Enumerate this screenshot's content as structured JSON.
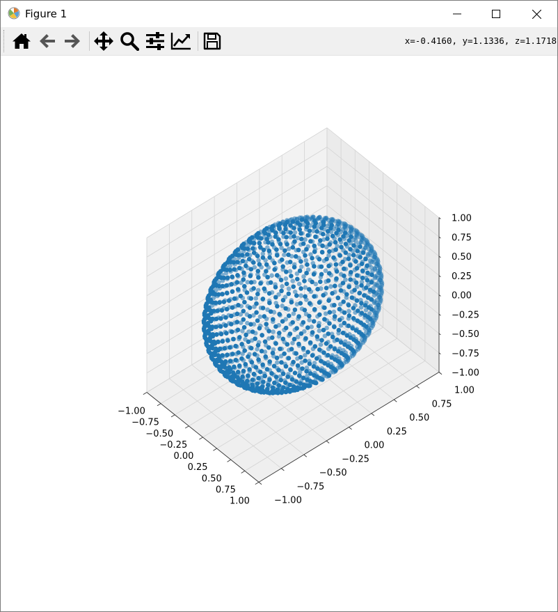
{
  "window": {
    "title": "Figure 1"
  },
  "toolbar": {
    "coords_text": "x=-0.4160, y=1.1336, z=1.1718",
    "buttons": [
      "home-icon",
      "back-arrow-icon",
      "forward-arrow-icon",
      "pan-move-icon",
      "zoom-magnifier-icon",
      "subplots-adjust-icon",
      "edit-axis-curve-icon",
      "save-floppy-icon"
    ]
  },
  "colors": {
    "marker": "#1f77b4",
    "pane": "#f2f2f2",
    "grid": "#d3d3d3"
  },
  "chart_data": {
    "type": "scatter",
    "projection": "3d",
    "description_points": "points evenly distributed on the unit sphere x^2+y^2+z^2=1",
    "point_count": 1500,
    "marker_color": "#1f77b4",
    "xlim": [
      -1.0,
      1.0
    ],
    "ylim": [
      -1.0,
      1.0
    ],
    "zlim": [
      -1.0,
      1.0
    ],
    "x_ticks": [
      "−1.00",
      "−0.75",
      "−0.50",
      "−0.25",
      "0.00",
      "0.25",
      "0.50",
      "0.75",
      "1.00"
    ],
    "y_ticks": [
      "−1.00",
      "−0.75",
      "−0.50",
      "−0.25",
      "0.00",
      "0.25",
      "0.50",
      "0.75",
      "1.00"
    ],
    "z_ticks": [
      "−1.00",
      "−0.75",
      "−0.50",
      "−0.25",
      "0.00",
      "0.25",
      "0.50",
      "0.75",
      "1.00"
    ],
    "grid": true,
    "title": "",
    "xlabel": "",
    "ylabel": "",
    "zlabel": ""
  }
}
